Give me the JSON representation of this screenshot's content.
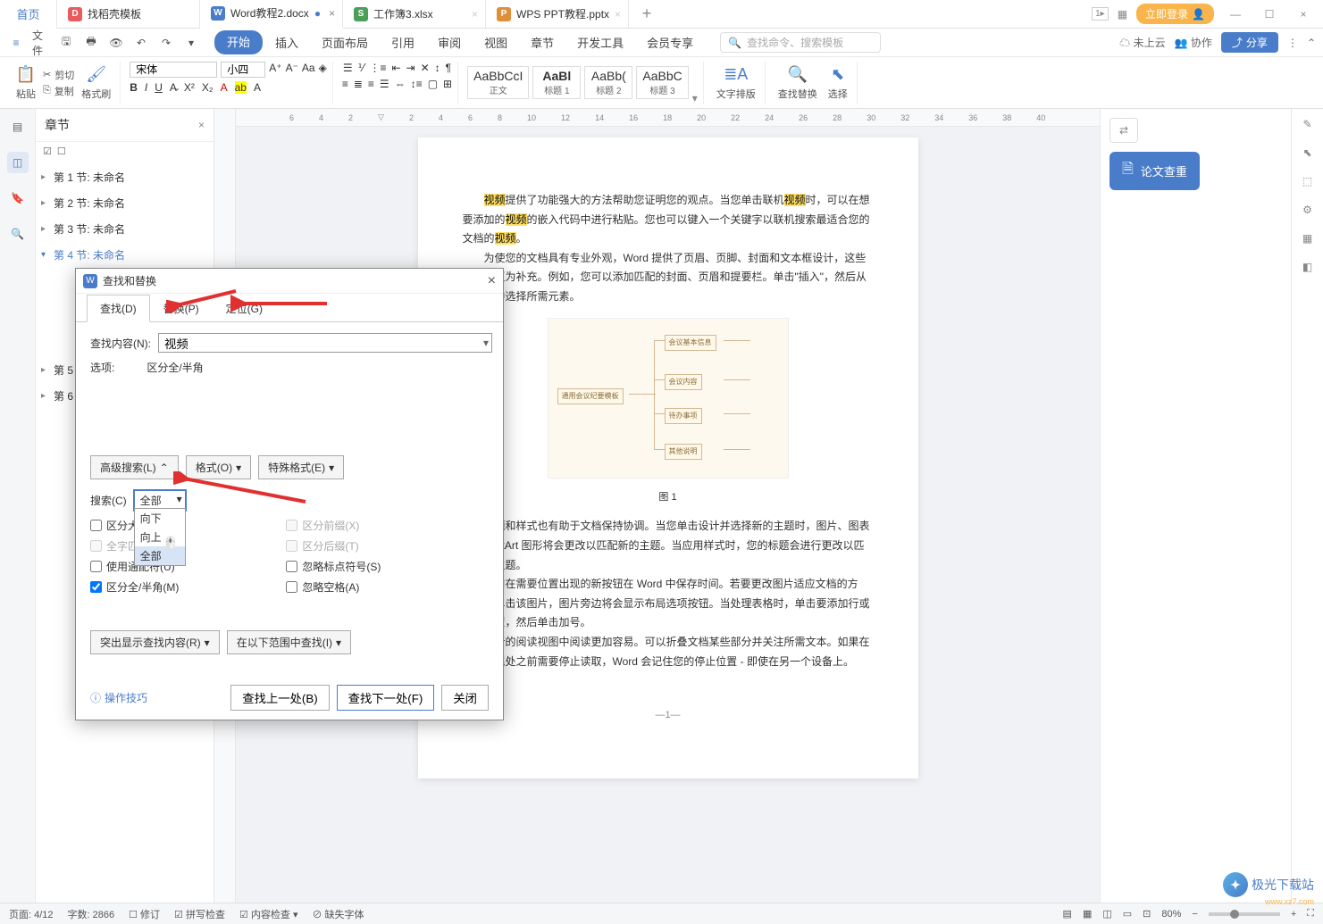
{
  "titlebar": {
    "home": "首页",
    "tabs": [
      {
        "icon": "rice",
        "label": "找稻壳模板"
      },
      {
        "icon": "word",
        "label": "Word教程2.docx",
        "active": true,
        "modified": true
      },
      {
        "icon": "xls",
        "label": "工作簿3.xlsx"
      },
      {
        "icon": "ppt",
        "label": "WPS PPT教程.pptx"
      }
    ],
    "login": "立即登录"
  },
  "menu": {
    "file": "文件",
    "tabs": [
      "开始",
      "插入",
      "页面布局",
      "引用",
      "审阅",
      "视图",
      "章节",
      "开发工具",
      "会员专享"
    ],
    "active_idx": 0,
    "search_placeholder": "查找命令、搜索模板",
    "cloud": "未上云",
    "coop": "协作",
    "share": "分享"
  },
  "ribbon": {
    "paste": "粘贴",
    "cut": "剪切",
    "copy": "复制",
    "format_painter": "格式刷",
    "font_name": "宋体",
    "font_size": "小四",
    "styles": [
      {
        "preview": "AaBbCcI",
        "label": "正文"
      },
      {
        "preview": "AaBl",
        "label": "标题 1"
      },
      {
        "preview": "AaBb(",
        "label": "标题 2"
      },
      {
        "preview": "AaBbC",
        "label": "标题 3"
      }
    ],
    "text_layout": "文字排版",
    "find_replace": "查找替换",
    "select": "选择"
  },
  "nav": {
    "title": "章节",
    "items": [
      "第 1 节: 未命名",
      "第 2 节: 未命名",
      "第 3 节: 未命名",
      "第 4 节: 未命名",
      "第 5 节: 未命名",
      "第 6 节: 未命名"
    ],
    "selected_idx": 3
  },
  "document": {
    "p1_a": "视频",
    "p1_b": "提供了功能强大的方法帮助您证明您的观点。当您单击联机",
    "p1_c": "视频",
    "p1_d": "时，可以在想要添加的",
    "p1_e": "视频",
    "p1_f": "的嵌入代码中进行粘贴。您也可以键入一个关键字以联机搜索最适合您的文档的",
    "p1_g": "视频",
    "p1_h": "。",
    "p2": "为使您的文档具有专业外观，Word 提供了页眉、页脚、封面和文本框设计，这些设计可互为补充。例如，您可以添加匹配的封面、页眉和提要栏。单击\"插入\"，然后从不同库中选择所需元素。",
    "fig_nodes": {
      "root": "通用会议纪要模板",
      "a": "会议基本信息",
      "b": "会议内容",
      "c": "待办事项",
      "d": "其他说明"
    },
    "fig_caption": "图 1",
    "p3": "主题和样式也有助于文档保持协调。当您单击设计并选择新的主题时，图片、图表或 SmartArt 图形将会更改以匹配新的主题。当应用样式时，您的标题会进行更改以匹配新的主题。",
    "p4": "使用在需要位置出现的新按钮在 Word 中保存时间。若要更改图片适应文档的方式，请单击该图片，图片旁边将会显示布局选项按钮。当处理表格时，单击要添加行或列的位置，然后单击加号。",
    "p5": "在新的阅读视图中阅读更加容易。可以折叠文档某些部分并关注所需文本。如果在达到结尾处之前需要停止读取，Word 会记住您的停止位置 - 即使在另一个设备上。",
    "page_num": "—1—"
  },
  "rightpane": {
    "check_duplicate": "论文查重"
  },
  "dialog": {
    "title": "查找和替换",
    "tabs": [
      "查找(D)",
      "替换(P)",
      "定位(G)"
    ],
    "active_tab": 0,
    "find_label": "查找内容(N):",
    "find_value": "视频",
    "options_label": "选项:",
    "options_value": "区分全/半角",
    "btn_advanced": "高级搜索(L)",
    "btn_format": "格式(O)",
    "btn_special": "特殊格式(E)",
    "search_label": "搜索(C)",
    "search_value": "全部",
    "search_options": [
      "向下",
      "向上",
      "全部"
    ],
    "search_hover_idx": 2,
    "checks_left": [
      {
        "label": "区分大小写(H)",
        "checked": false,
        "disabled": false
      },
      {
        "label": "全字匹配(Y)",
        "checked": false,
        "disabled": true
      },
      {
        "label": "使用通配符(U)",
        "checked": false,
        "disabled": false
      },
      {
        "label": "区分全/半角(M)",
        "checked": true,
        "disabled": false
      }
    ],
    "checks_right": [
      {
        "label": "区分前缀(X)",
        "checked": false,
        "disabled": true
      },
      {
        "label": "区分后缀(T)",
        "checked": false,
        "disabled": true
      },
      {
        "label": "忽略标点符号(S)",
        "checked": false,
        "disabled": false
      },
      {
        "label": "忽略空格(A)",
        "checked": false,
        "disabled": false
      }
    ],
    "btn_highlight": "突出显示查找内容(R)",
    "btn_find_in": "在以下范围中查找(I)",
    "link_tips": "操作技巧",
    "btn_prev": "查找上一处(B)",
    "btn_next": "查找下一处(F)",
    "btn_close": "关闭"
  },
  "status": {
    "page": "页面: 4/12",
    "words": "字数: 2866",
    "revise": "修订",
    "spell": "拼写检查",
    "content": "内容检查",
    "font_missing": "缺失字体",
    "zoom": "80%"
  },
  "watermark": {
    "text": "极光下载站",
    "sub": "www.xz7.com"
  }
}
